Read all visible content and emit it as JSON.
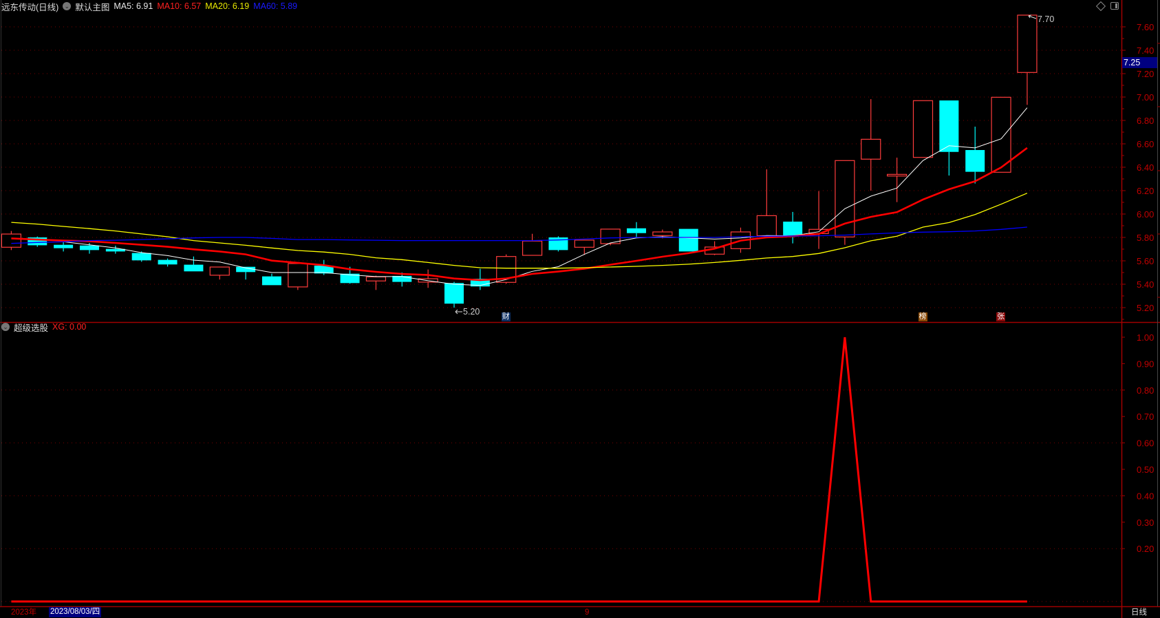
{
  "header": {
    "stock_name": "远东传动(日线)",
    "template": "默认主图",
    "ma": [
      {
        "label": "MA5: 6.91",
        "color": "#e8e8e8"
      },
      {
        "label": "MA10: 6.57",
        "color": "#ff2020"
      },
      {
        "label": "MA20: 6.19",
        "color": "#e8e800"
      },
      {
        "label": "MA60: 5.89",
        "color": "#1a1aff"
      }
    ],
    "icons": [
      "diamond-icon",
      "panel-toggle-icon",
      "collapse-circle-icon"
    ]
  },
  "current_price": "7.25",
  "annotations": {
    "low_label": "5.20",
    "high_label": "7.70"
  },
  "badges": [
    {
      "text": "财",
      "candle": 19,
      "bg": "#0b2f63"
    },
    {
      "text": "榜",
      "candle": 35,
      "bg": "#8a4a06"
    },
    {
      "text": "张",
      "candle": 38,
      "bg": "#8a0a0a"
    }
  ],
  "sub": {
    "title": "超级选股",
    "value_label": "XG: 0.00"
  },
  "xaxis": {
    "year": "2023年",
    "cursor_date": "2023/08/03/四",
    "month": "9",
    "period": "日线"
  },
  "colors": {
    "up": "#ff3c3c",
    "down": "#00ffff",
    "axis": "#a00000",
    "grid": "#7a0000",
    "ma5": "#ffffff",
    "ma10": "#ff0000",
    "ma20": "#ffff00",
    "ma60": "#0000ff",
    "xg": "#ff0000"
  },
  "chart_data": [
    {
      "type": "candlestick",
      "ylim": [
        5.15,
        7.83
      ],
      "yticks": [
        "7.60",
        "7.40",
        "7.20",
        "7.00",
        "6.80",
        "6.60",
        "6.40",
        "6.20",
        "6.00",
        "5.80",
        "5.60",
        "5.40",
        "5.20"
      ],
      "grid": true,
      "ohlc": [
        [
          5.716,
          5.855,
          5.692,
          5.829
        ],
        [
          5.8,
          5.808,
          5.72,
          5.733
        ],
        [
          5.737,
          5.763,
          5.68,
          5.708
        ],
        [
          5.731,
          5.753,
          5.661,
          5.692
        ],
        [
          5.702,
          5.73,
          5.661,
          5.68
        ],
        [
          5.667,
          5.68,
          5.592,
          5.604
        ],
        [
          5.608,
          5.62,
          5.551,
          5.569
        ],
        [
          5.567,
          5.637,
          5.51,
          5.51
        ],
        [
          5.477,
          5.547,
          5.44,
          5.547
        ],
        [
          5.549,
          5.549,
          5.44,
          5.504
        ],
        [
          5.467,
          5.49,
          5.392,
          5.392
        ],
        [
          5.377,
          5.577,
          5.351,
          5.577
        ],
        [
          5.559,
          5.608,
          5.479,
          5.492
        ],
        [
          5.49,
          5.549,
          5.404,
          5.41
        ],
        [
          5.428,
          5.473,
          5.351,
          5.463
        ],
        [
          5.471,
          5.5,
          5.38,
          5.42
        ],
        [
          5.418,
          5.526,
          5.369,
          5.447
        ],
        [
          5.41,
          5.42,
          5.2,
          5.234
        ],
        [
          5.447,
          5.532,
          5.351,
          5.381
        ],
        [
          5.416,
          5.655,
          5.404,
          5.637
        ],
        [
          5.647,
          5.831,
          5.647,
          5.769
        ],
        [
          5.8,
          5.81,
          5.68,
          5.692
        ],
        [
          5.716,
          5.777,
          5.651,
          5.777
        ],
        [
          5.747,
          5.871,
          5.733,
          5.871
        ],
        [
          5.878,
          5.931,
          5.804,
          5.837
        ],
        [
          5.816,
          5.867,
          5.792,
          5.847
        ],
        [
          5.873,
          5.873,
          5.68,
          5.68
        ],
        [
          5.657,
          5.767,
          5.649,
          5.718
        ],
        [
          5.704,
          5.884,
          5.669,
          5.847
        ],
        [
          5.814,
          6.382,
          5.814,
          5.986
        ],
        [
          5.935,
          6.018,
          5.749,
          5.818
        ],
        [
          5.833,
          6.196,
          5.702,
          5.869
        ],
        [
          5.804,
          6.457,
          5.737,
          6.457
        ],
        [
          6.469,
          6.982,
          6.2,
          6.639
        ],
        [
          6.325,
          6.482,
          6.102,
          6.339
        ],
        [
          6.484,
          6.969,
          6.484,
          6.969
        ],
        [
          6.971,
          6.971,
          6.329,
          6.531
        ],
        [
          6.547,
          6.747,
          6.261,
          6.361
        ],
        [
          6.357,
          6.998,
          6.357,
          6.998
        ],
        [
          7.21,
          7.7,
          6.933,
          7.7
        ]
      ],
      "series": [
        {
          "name": "MA5",
          "values": [
            null,
            null,
            5.763,
            5.737,
            5.71,
            5.67,
            5.645,
            5.606,
            5.59,
            5.54,
            5.5,
            5.5,
            5.5,
            5.48,
            5.465,
            5.465,
            5.43,
            5.4,
            5.39,
            5.44,
            5.51,
            5.55,
            5.655,
            5.753,
            5.796,
            5.806,
            5.796,
            5.786,
            5.796,
            5.816,
            5.814,
            5.849,
            6.045,
            6.153,
            6.222,
            6.457,
            6.584,
            6.565,
            6.643,
            6.908
          ]
        },
        {
          "name": "MA10",
          "values": [
            5.792,
            5.782,
            5.773,
            5.767,
            5.753,
            5.737,
            5.72,
            5.698,
            5.68,
            5.655,
            5.602,
            5.583,
            5.563,
            5.528,
            5.506,
            5.488,
            5.479,
            5.449,
            5.435,
            5.449,
            5.488,
            5.508,
            5.533,
            5.567,
            5.6,
            5.635,
            5.665,
            5.704,
            5.773,
            5.8,
            5.81,
            5.83,
            5.918,
            5.976,
            6.016,
            6.124,
            6.212,
            6.28,
            6.398,
            6.565
          ]
        },
        {
          "name": "MA20",
          "values": [
            5.929,
            5.914,
            5.894,
            5.875,
            5.855,
            5.83,
            5.806,
            5.773,
            5.753,
            5.733,
            5.71,
            5.688,
            5.675,
            5.655,
            5.626,
            5.61,
            5.586,
            5.561,
            5.541,
            5.537,
            5.537,
            5.537,
            5.541,
            5.547,
            5.553,
            5.561,
            5.571,
            5.586,
            5.604,
            5.624,
            5.637,
            5.663,
            5.712,
            5.771,
            5.81,
            5.888,
            5.927,
            5.996,
            6.084,
            6.178
          ]
        },
        {
          "name": "MA60",
          "values": [
            5.749,
            5.757,
            5.763,
            5.773,
            5.776,
            5.782,
            5.788,
            5.796,
            5.8,
            5.8,
            5.792,
            5.782,
            5.782,
            5.778,
            5.776,
            5.773,
            5.773,
            5.773,
            5.773,
            5.773,
            5.773,
            5.778,
            5.786,
            5.796,
            5.8,
            5.8,
            5.8,
            5.8,
            5.806,
            5.81,
            5.812,
            5.814,
            5.82,
            5.83,
            5.839,
            5.845,
            5.849,
            5.855,
            5.869,
            5.888
          ]
        }
      ]
    },
    {
      "type": "line",
      "ylim": [
        0,
        1.05
      ],
      "yticks": [
        "1.00",
        "0.90",
        "0.80",
        "0.70",
        "0.60",
        "0.50",
        "0.40",
        "0.30",
        "0.20"
      ],
      "series": [
        {
          "name": "XG",
          "values": [
            0,
            0,
            0,
            0,
            0,
            0,
            0,
            0,
            0,
            0,
            0,
            0,
            0,
            0,
            0,
            0,
            0,
            0,
            0,
            0,
            0,
            0,
            0,
            0,
            0,
            0,
            0,
            0,
            0,
            0,
            0,
            0,
            1,
            0,
            0,
            0,
            0,
            0,
            0,
            0
          ]
        }
      ]
    }
  ]
}
